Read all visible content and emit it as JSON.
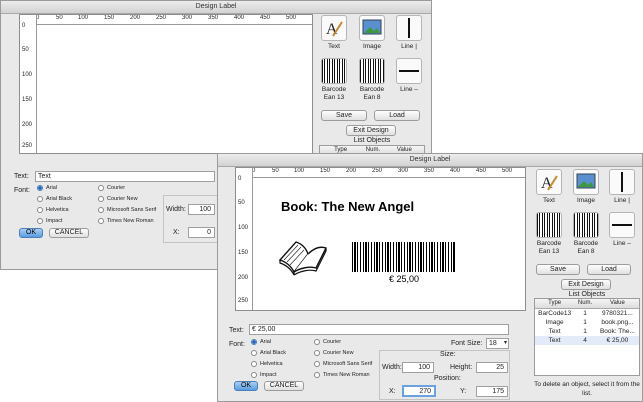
{
  "back_window": {
    "title": "Design Label",
    "ruler_top": [
      "0",
      "50",
      "100",
      "150",
      "200",
      "250",
      "300",
      "350",
      "400",
      "450",
      "500"
    ],
    "ruler_left": [
      "0",
      "50",
      "100",
      "150",
      "200",
      "250"
    ],
    "tools": [
      {
        "label": "Text"
      },
      {
        "label": "Image"
      },
      {
        "label": "Line |"
      },
      {
        "label": "Barcode Ean 13"
      },
      {
        "label": "Barcode Ean 8"
      },
      {
        "label": "Line –"
      }
    ],
    "save_label": "Save",
    "load_label": "Load",
    "exit_label": "Exit Design",
    "list_objects_title": "List Objects",
    "list_columns": [
      "Type",
      "Num.",
      "Value"
    ],
    "text_label": "Text:",
    "text_value": "Text",
    "font_label": "Font:",
    "fonts": [
      "Arial",
      "Arial Black",
      "Helvetica",
      "Impact",
      "Courier",
      "Courier New",
      "Microsoft Sans Serif",
      "Times New Roman"
    ],
    "selected_font": "Arial",
    "width_label": "Width:",
    "width_value": "100",
    "x_label": "X:",
    "x_value": "0",
    "ok_label": "OK",
    "cancel_label": "CANCEL"
  },
  "front_window": {
    "title": "Design Label",
    "ruler_top": [
      "0",
      "50",
      "100",
      "150",
      "200",
      "250",
      "300",
      "350",
      "400",
      "450",
      "500"
    ],
    "ruler_left": [
      "0",
      "50",
      "100",
      "150",
      "200",
      "250"
    ],
    "label_title": "Book: The New Angel",
    "price": "€ 25,00",
    "tools": [
      {
        "label": "Text"
      },
      {
        "label": "Image"
      },
      {
        "label": "Line |"
      },
      {
        "label": "Barcode Ean 13"
      },
      {
        "label": "Barcode Ean 8"
      },
      {
        "label": "Line –"
      }
    ],
    "save_label": "Save",
    "load_label": "Load",
    "exit_label": "Exit Design",
    "list_objects_title": "List Objects",
    "list_columns": [
      "Type",
      "Num.",
      "Value"
    ],
    "list_rows": [
      [
        "BarCode13",
        "1",
        "9780321..."
      ],
      [
        "Image",
        "1",
        "book.png..."
      ],
      [
        "Text",
        "1",
        "Book: The..."
      ],
      [
        "Text",
        "4",
        "€ 25,00"
      ]
    ],
    "delete_hint": "To delete an object, select it from the list.",
    "text_label": "Text:",
    "text_value": "€ 25,00",
    "font_label": "Font:",
    "fonts": [
      "Arial",
      "Arial Black",
      "Helvetica",
      "Impact",
      "Courier",
      "Courier New",
      "Microsoft Sans Serif",
      "Times New Roman"
    ],
    "selected_font": "Arial",
    "font_size_label": "Font Size:",
    "font_size_value": "18",
    "size_title": "Size:",
    "width_label": "Width:",
    "width_value": "100",
    "height_label": "Height:",
    "height_value": "25",
    "position_title": "Position:",
    "x_label": "X:",
    "x_value": "270",
    "y_label": "Y:",
    "y_value": "175",
    "ok_label": "OK",
    "cancel_label": "CANCEL"
  },
  "colors": {
    "window_bg": "#e9e9e9",
    "accent_button": "#5b9be0",
    "text": "#222222"
  }
}
